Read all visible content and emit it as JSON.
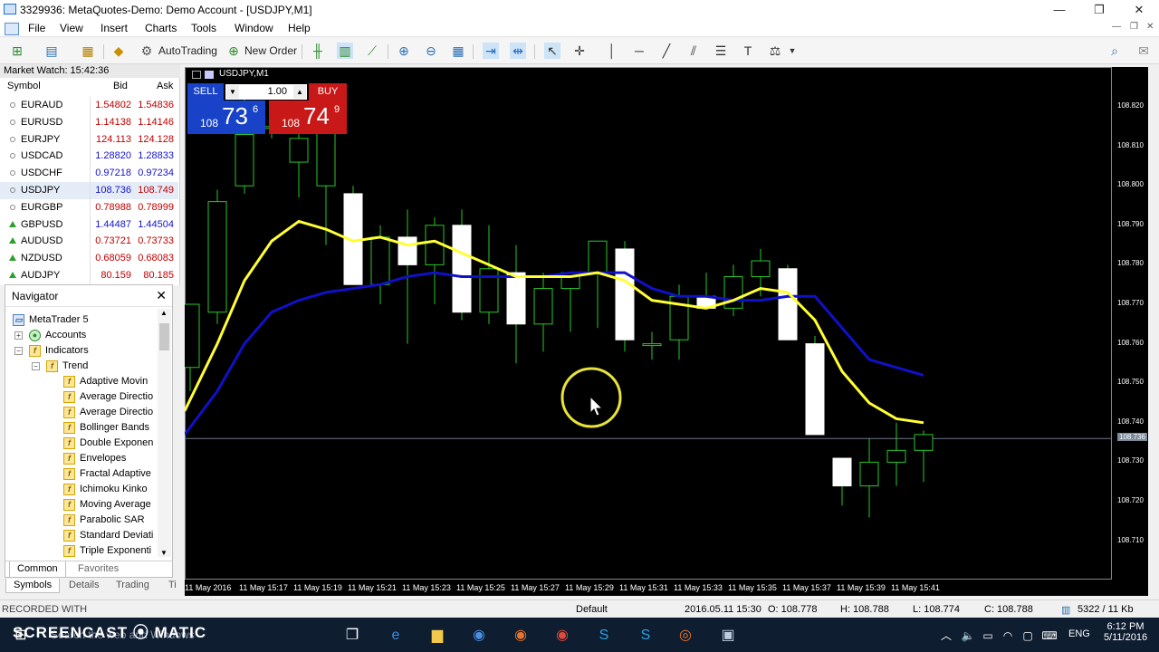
{
  "window": {
    "title": "3329936: MetaQuotes-Demo: Demo Account - [USDJPY,M1]",
    "min": "—",
    "restore": "❐",
    "close": "✕"
  },
  "menu": {
    "items": [
      "File",
      "View",
      "Insert",
      "Charts",
      "Tools",
      "Window",
      "Help"
    ]
  },
  "toolbar": {
    "autotrading": "AutoTrading",
    "new_order": "New Order"
  },
  "market_watch": {
    "title": "Market Watch: 15:42:36",
    "col_symbol": "Symbol",
    "col_bid": "Bid",
    "col_ask": "Ask",
    "rows": [
      {
        "symbol": "EURAUD",
        "bid": "1.54802",
        "ask": "1.54836",
        "dir": "flat",
        "color": "red"
      },
      {
        "symbol": "EURUSD",
        "bid": "1.14138",
        "ask": "1.14146",
        "dir": "flat",
        "color": "red"
      },
      {
        "symbol": "EURJPY",
        "bid": "124.113",
        "ask": "124.128",
        "dir": "flat",
        "color": "red"
      },
      {
        "symbol": "USDCAD",
        "bid": "1.28820",
        "ask": "1.28833",
        "dir": "flat",
        "color": "blue"
      },
      {
        "symbol": "USDCHF",
        "bid": "0.97218",
        "ask": "0.97234",
        "dir": "flat",
        "color": "blue"
      },
      {
        "symbol": "USDJPY",
        "bid": "108.736",
        "ask": "108.749",
        "dir": "flat",
        "color": "mixed"
      },
      {
        "symbol": "EURGBP",
        "bid": "0.78988",
        "ask": "0.78999",
        "dir": "flat",
        "color": "red"
      },
      {
        "symbol": "GBPUSD",
        "bid": "1.44487",
        "ask": "1.44504",
        "dir": "up",
        "color": "blue"
      },
      {
        "symbol": "AUDUSD",
        "bid": "0.73721",
        "ask": "0.73733",
        "dir": "up",
        "color": "red"
      },
      {
        "symbol": "NZDUSD",
        "bid": "0.68059",
        "ask": "0.68083",
        "dir": "up",
        "color": "red"
      },
      {
        "symbol": "AUDJPY",
        "bid": "80.159",
        "ask": "80.185",
        "dir": "up",
        "color": "red"
      }
    ]
  },
  "navigator": {
    "title": "Navigator",
    "root": "MetaTrader 5",
    "accounts": "Accounts",
    "indicators": "Indicators",
    "trend": "Trend",
    "items": [
      "Adaptive Movin",
      "Average Directio",
      "Average Directio",
      "Bollinger Bands",
      "Double Exponen",
      "Envelopes",
      "Fractal Adaptive",
      "Ichimoku Kinko",
      "Moving Average",
      "Parabolic SAR",
      "Standard Deviati",
      "Triple Exponenti"
    ],
    "tabs": [
      "Common",
      "Favorites"
    ]
  },
  "bottom_tabs": [
    "Symbols",
    "Details",
    "Trading",
    "Ti"
  ],
  "trade_panel": {
    "symbol_label": "USDJPY,M1",
    "sell": "SELL",
    "buy": "BUY",
    "lot": "1.00",
    "sell_small": "108",
    "sell_big": "73",
    "sell_sup": "6",
    "buy_small": "108",
    "buy_big": "74",
    "buy_sup": "9"
  },
  "chart_data": {
    "type": "candlestick",
    "symbol": "USDJPY,M1",
    "ylim": [
      108.7,
      108.83
    ],
    "y_ticks": [
      "108.820",
      "108.810",
      "108.800",
      "108.790",
      "108.780",
      "108.770",
      "108.760",
      "108.750",
      "108.740",
      "108.730",
      "108.720",
      "108.710"
    ],
    "current_price_label": "108.736",
    "current_price": 108.736,
    "x_ticks": [
      "11 May 2016",
      "11 May 15:17",
      "11 May 15:19",
      "11 May 15:21",
      "11 May 15:23",
      "11 May 15:25",
      "11 May 15:27",
      "11 May 15:29",
      "11 May 15:31",
      "11 May 15:33",
      "11 May 15:35",
      "11 May 15:37",
      "11 May 15:39",
      "11 May 15:41"
    ],
    "candles": [
      {
        "o": 108.754,
        "h": 108.77,
        "l": 108.748,
        "c": 108.77
      },
      {
        "o": 108.768,
        "h": 108.799,
        "l": 108.765,
        "c": 108.796
      },
      {
        "o": 108.8,
        "h": 108.824,
        "l": 108.798,
        "c": 108.813
      },
      {
        "o": 108.815,
        "h": 108.818,
        "l": 108.812,
        "c": 108.815
      },
      {
        "o": 108.806,
        "h": 108.82,
        "l": 108.797,
        "c": 108.812
      },
      {
        "o": 108.8,
        "h": 108.818,
        "l": 108.785,
        "c": 108.815
      },
      {
        "o": 108.798,
        "h": 108.8,
        "l": 108.778,
        "c": 108.775
      },
      {
        "o": 108.775,
        "h": 108.79,
        "l": 108.77,
        "c": 108.787
      },
      {
        "o": 108.787,
        "h": 108.794,
        "l": 108.76,
        "c": 108.78
      },
      {
        "o": 108.78,
        "h": 108.792,
        "l": 108.77,
        "c": 108.79
      },
      {
        "o": 108.79,
        "h": 108.794,
        "l": 108.766,
        "c": 108.768
      },
      {
        "o": 108.768,
        "h": 108.79,
        "l": 108.765,
        "c": 108.779
      },
      {
        "o": 108.778,
        "h": 108.785,
        "l": 108.755,
        "c": 108.765
      },
      {
        "o": 108.765,
        "h": 108.778,
        "l": 108.758,
        "c": 108.774
      },
      {
        "o": 108.774,
        "h": 108.778,
        "l": 108.763,
        "c": 108.778
      },
      {
        "o": 108.778,
        "h": 108.786,
        "l": 108.764,
        "c": 108.786
      },
      {
        "o": 108.784,
        "h": 108.786,
        "l": 108.758,
        "c": 108.761
      },
      {
        "o": 108.76,
        "h": 108.763,
        "l": 108.756,
        "c": 108.76
      },
      {
        "o": 108.761,
        "h": 108.775,
        "l": 108.756,
        "c": 108.772
      },
      {
        "o": 108.772,
        "h": 108.778,
        "l": 108.769,
        "c": 108.769
      },
      {
        "o": 108.769,
        "h": 108.78,
        "l": 108.767,
        "c": 108.777
      },
      {
        "o": 108.777,
        "h": 108.784,
        "l": 108.772,
        "c": 108.781
      },
      {
        "o": 108.779,
        "h": 108.78,
        "l": 108.761,
        "c": 108.761
      },
      {
        "o": 108.76,
        "h": 108.762,
        "l": 108.737,
        "c": 108.737
      },
      {
        "o": 108.731,
        "h": 108.731,
        "l": 108.719,
        "c": 108.724
      },
      {
        "o": 108.724,
        "h": 108.736,
        "l": 108.716,
        "c": 108.73
      },
      {
        "o": 108.73,
        "h": 108.74,
        "l": 108.724,
        "c": 108.733
      },
      {
        "o": 108.733,
        "h": 108.738,
        "l": 108.725,
        "c": 108.737
      }
    ],
    "ma_fast": [
      108.743,
      108.76,
      108.776,
      108.786,
      108.791,
      108.789,
      108.786,
      108.787,
      108.785,
      108.786,
      108.783,
      108.78,
      108.777,
      108.777,
      108.777,
      108.778,
      108.776,
      108.771,
      108.77,
      108.769,
      108.771,
      108.774,
      108.773,
      108.766,
      108.753,
      108.745,
      108.741,
      108.74
    ],
    "ma_slow": [
      108.737,
      108.748,
      108.76,
      108.768,
      108.771,
      108.773,
      108.774,
      108.775,
      108.777,
      108.778,
      108.777,
      108.777,
      108.777,
      108.777,
      108.778,
      108.778,
      108.778,
      108.774,
      108.772,
      108.772,
      108.771,
      108.771,
      108.772,
      108.772,
      108.764,
      108.756,
      108.754,
      108.752
    ],
    "colors": {
      "ma_fast": "#ffff33",
      "ma_slow": "#1010c8",
      "candle": "#28c828"
    }
  },
  "status": {
    "profile": "Default",
    "time": "2016.05.11 15:30",
    "open": "O: 108.778",
    "high": "H: 108.788",
    "low": "L: 108.774",
    "close": "C: 108.788",
    "traffic": "5322 / 11 Kb",
    "recorded": "RECORDED WITH"
  },
  "taskbar": {
    "search": "Search the web and Windows",
    "badge": "SCREENCAST ⦿ MATIC",
    "lang": "ENG",
    "clock_time": "6:12 PM",
    "clock_date": "5/11/2016"
  }
}
